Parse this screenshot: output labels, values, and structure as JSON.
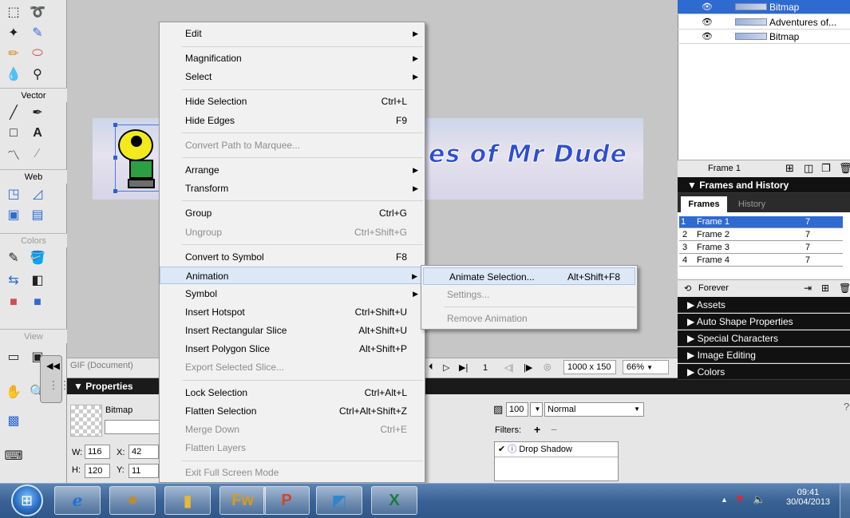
{
  "tools": {
    "sections": [
      "Vector",
      "Web",
      "Colors",
      "View"
    ]
  },
  "banner": {
    "text": "es of Mr Dude"
  },
  "statusbar": {
    "doc_label": "GIF (Document)",
    "frame_number": "1",
    "canvas_size": "1000 x 150",
    "zoom": "66%"
  },
  "properties": {
    "header": "▼ Properties",
    "object_type": "Bitmap",
    "w_label": "W:",
    "w_value": "116",
    "h_label": "H:",
    "h_value": "120",
    "x_label": "X:",
    "x_value": "42",
    "y_label": "Y:",
    "y_value": "11",
    "opacity": "100",
    "blend_mode": "Normal",
    "filters_label": "Filters:",
    "filter_item": "Drop Shadow"
  },
  "layers": {
    "rows": [
      {
        "name": "Bitmap"
      },
      {
        "name": "Adventures of..."
      },
      {
        "name": "Bitmap"
      }
    ],
    "footer_label": "Frame 1"
  },
  "frames_panel": {
    "header": "▼ Frames and History",
    "tab_frames": "Frames",
    "tab_history": "History",
    "rows": [
      {
        "num": "1",
        "name": "Frame 1",
        "delay": "7"
      },
      {
        "num": "2",
        "name": "Frame 2",
        "delay": "7"
      },
      {
        "num": "3",
        "name": "Frame 3",
        "delay": "7"
      },
      {
        "num": "4",
        "name": "Frame 4",
        "delay": "7"
      }
    ],
    "loop_label": "Forever"
  },
  "collapsed_panels": [
    "▶ Assets",
    "▶ Auto Shape Properties",
    "▶ Special Characters",
    "▶ Image Editing",
    "▶ Colors"
  ],
  "context_menu": {
    "items": [
      {
        "label": "Edit",
        "key": "",
        "submenu": true,
        "disabled": false
      },
      {
        "label": "Magnification",
        "key": "",
        "submenu": true,
        "disabled": false
      },
      {
        "label": "Select",
        "key": "",
        "submenu": true,
        "disabled": false
      },
      {
        "label": "Hide Selection",
        "key": "Ctrl+L",
        "submenu": false,
        "disabled": false
      },
      {
        "label": "Hide Edges",
        "key": "F9",
        "submenu": false,
        "disabled": false
      },
      {
        "label": "Convert Path to Marquee...",
        "key": "",
        "submenu": false,
        "disabled": true
      },
      {
        "label": "Arrange",
        "key": "",
        "submenu": true,
        "disabled": false
      },
      {
        "label": "Transform",
        "key": "",
        "submenu": true,
        "disabled": false
      },
      {
        "label": "Group",
        "key": "Ctrl+G",
        "submenu": false,
        "disabled": false
      },
      {
        "label": "Ungroup",
        "key": "Ctrl+Shift+G",
        "submenu": false,
        "disabled": true
      },
      {
        "label": "Convert to Symbol",
        "key": "F8",
        "submenu": false,
        "disabled": false
      },
      {
        "label": "Animation",
        "key": "",
        "submenu": true,
        "disabled": false,
        "highlighted": true
      },
      {
        "label": "Symbol",
        "key": "",
        "submenu": true,
        "disabled": false
      },
      {
        "label": "Insert Hotspot",
        "key": "Ctrl+Shift+U",
        "submenu": false,
        "disabled": false
      },
      {
        "label": "Insert Rectangular Slice",
        "key": "Alt+Shift+U",
        "submenu": false,
        "disabled": false
      },
      {
        "label": "Insert Polygon Slice",
        "key": "Alt+Shift+P",
        "submenu": false,
        "disabled": false
      },
      {
        "label": "Export Selected Slice...",
        "key": "",
        "submenu": false,
        "disabled": true
      },
      {
        "label": "Lock Selection",
        "key": "Ctrl+Alt+L",
        "submenu": false,
        "disabled": false
      },
      {
        "label": "Flatten Selection",
        "key": "Ctrl+Alt+Shift+Z",
        "submenu": false,
        "disabled": false
      },
      {
        "label": "Merge Down",
        "key": "Ctrl+E",
        "submenu": false,
        "disabled": true
      },
      {
        "label": "Flatten Layers",
        "key": "",
        "submenu": false,
        "disabled": true
      },
      {
        "label": "Exit Full Screen Mode",
        "key": "",
        "submenu": false,
        "disabled": true
      }
    ]
  },
  "animation_submenu": {
    "items": [
      {
        "label": "Animate Selection...",
        "key": "Alt+Shift+F8",
        "disabled": false
      },
      {
        "label": "Settings...",
        "key": "",
        "disabled": true
      },
      {
        "label": "Remove Animation",
        "key": "",
        "disabled": true
      }
    ]
  },
  "taskbar": {
    "time": "09:41",
    "date": "30/04/2013",
    "apps": [
      "internet-explorer",
      "fireworks-tool",
      "file-explorer",
      "fireworks",
      "powerpoint",
      "paint",
      "excel"
    ]
  }
}
